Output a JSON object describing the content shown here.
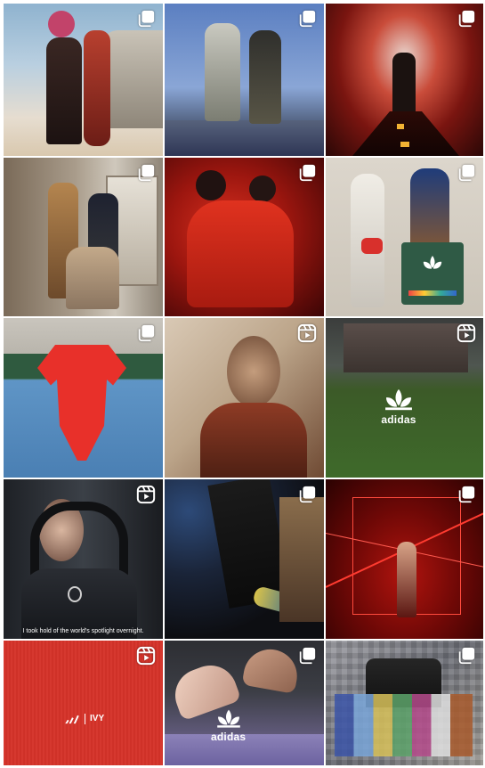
{
  "grid": {
    "tiles": [
      {
        "id": 1,
        "badge": "carousel-icon"
      },
      {
        "id": 2,
        "badge": "carousel-icon"
      },
      {
        "id": 3,
        "badge": "carousel-icon"
      },
      {
        "id": 4,
        "badge": "carousel-icon"
      },
      {
        "id": 5,
        "badge": "carousel-icon"
      },
      {
        "id": 6,
        "badge": "carousel-icon"
      },
      {
        "id": 7,
        "badge": "carousel-icon"
      },
      {
        "id": 8,
        "badge": "reels-icon"
      },
      {
        "id": 9,
        "badge": "reels-icon"
      },
      {
        "id": 10,
        "badge": "reels-icon"
      },
      {
        "id": 11,
        "badge": "carousel-icon"
      },
      {
        "id": 12,
        "badge": "carousel-icon"
      },
      {
        "id": 13,
        "badge": "reels-icon"
      },
      {
        "id": 14,
        "badge": "carousel-icon"
      },
      {
        "id": 15,
        "badge": "carousel-icon"
      }
    ]
  },
  "logos": {
    "field_wordmark": "adidas",
    "tile14_wordmark": "adidas",
    "tile13_collab": "IVY"
  },
  "captions": {
    "tile10": "I took hold of the world's spotlight overnight."
  },
  "colors": {
    "accent_red": "#d8302c",
    "field_green": "#3c5a28",
    "badge_white": "#ffffff"
  }
}
